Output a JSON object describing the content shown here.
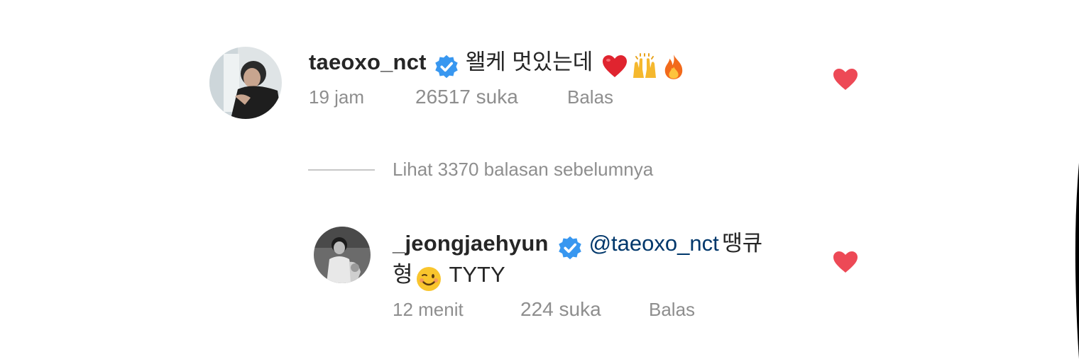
{
  "comment": {
    "username": "taeoxo_nct",
    "text": "왤케 멋있는데",
    "emojis": [
      "red-heart-emoji",
      "raising-hands-emoji",
      "fire-emoji"
    ],
    "time": "19 jam",
    "likes": "26517 suka",
    "reply_label": "Balas",
    "liked": true
  },
  "view_replies": {
    "label": "Lihat 3370 balasan sebelumnya"
  },
  "reply": {
    "username": "_jeongjaehyun",
    "mention": "@taeoxo_nct",
    "text_line1": "땡큐",
    "text_line2_prefix": "형",
    "text_line2_suffix": "TYTY",
    "emoji": "winking-face-emoji",
    "time": "12 menit",
    "likes": "224 suka",
    "reply_label": "Balas",
    "liked": true
  },
  "colors": {
    "heart": "#ed4956",
    "verified": "#3897f0",
    "mention": "#00376b",
    "meta": "#8e8e8e"
  }
}
